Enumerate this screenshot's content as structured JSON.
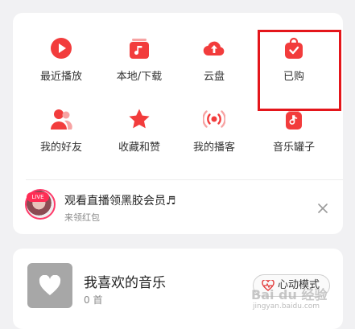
{
  "grid": {
    "items": [
      {
        "label": "最近播放",
        "icon": "play-icon"
      },
      {
        "label": "本地/下载",
        "icon": "music-folder-icon"
      },
      {
        "label": "云盘",
        "icon": "cloud-upload-icon"
      },
      {
        "label": "已购",
        "icon": "shopping-bag-check-icon"
      },
      {
        "label": "我的好友",
        "icon": "friends-icon"
      },
      {
        "label": "收藏和赞",
        "icon": "star-icon"
      },
      {
        "label": "我的播客",
        "icon": "podcast-icon"
      },
      {
        "label": "音乐罐子",
        "icon": "music-jar-icon"
      }
    ]
  },
  "promo": {
    "live_tag": "LIVE",
    "title": "观看直播领黑胶会员♬",
    "subtitle": "来领红包"
  },
  "liked": {
    "title": "我喜欢的音乐",
    "count": "0 首",
    "heartbeat_label": "心动模式"
  },
  "watermark": {
    "text": "Bai du 经验",
    "sub": "jingyan.baidu.com"
  },
  "colors": {
    "accent": "#f23c3c",
    "highlight_box": "#e4161b",
    "cover": "#a7a7a7"
  }
}
